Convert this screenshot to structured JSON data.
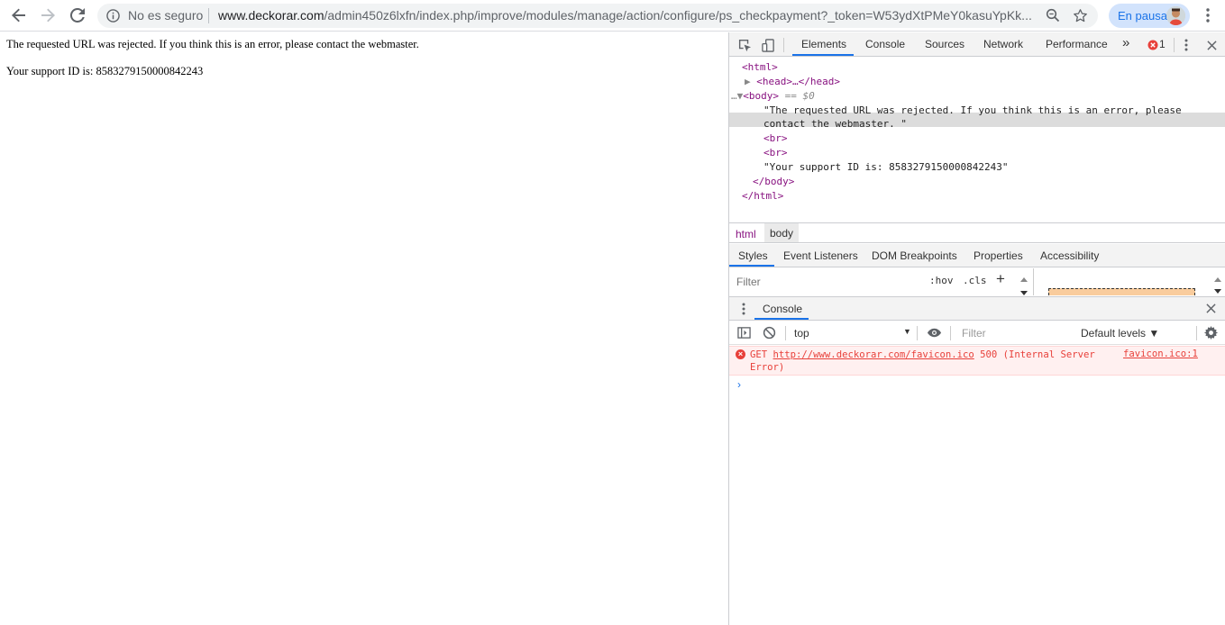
{
  "browser": {
    "security_label": "No es seguro",
    "url_host": "www.deckorar.com",
    "url_path": "/admin450z6lxfn/index.php/improve/modules/manage/action/configure/ps_checkpayment?_token=W53ydXtPMeY0kasuYpKk...",
    "profile_label": "En pausa",
    "icons": [
      "back-icon",
      "forward-icon",
      "reload-icon",
      "info-icon",
      "zoom-icon",
      "star-icon",
      "menu-dots-icon"
    ]
  },
  "page": {
    "line1": "The requested URL was rejected. If you think this is an error, please contact the webmaster.",
    "line2": "Your support ID is: 8583279150000842243"
  },
  "devtools": {
    "tabs": [
      "Elements",
      "Console",
      "Sources",
      "Network",
      "Performance"
    ],
    "more": "»",
    "error_count": "1",
    "dom": {
      "html_open": "<html>",
      "head_collapsed": "<head>…</head>",
      "body_open": "<body>",
      "selected_marker": "== $0",
      "text1": "\"The requested URL was rejected. If you think this is an error, please",
      "text1_cont": "contact the webmaster. \"",
      "br1": "<br>",
      "br2": "<br>",
      "text2": "\"Your support ID is: 8583279150000842243\"",
      "body_close": "</body>",
      "html_close": "</html>"
    },
    "breadcrumbs": [
      "html",
      "body"
    ],
    "sub_tabs": [
      "Styles",
      "Event Listeners",
      "DOM Breakpoints",
      "Properties",
      "Accessibility"
    ],
    "styles_filter_placeholder": "Filter",
    "hov": ":hov",
    "cls": ".cls",
    "plus": "+",
    "drawer_title": "Console",
    "console": {
      "context": "top",
      "filter_placeholder": "Filter",
      "levels": "Default levels ▼",
      "error_method": "GET",
      "error_url": "http://www.deckorar.com/favicon.ico",
      "error_status": "500 (Internal Server",
      "error_status_cont": "Error)",
      "error_source": "favicon.ico:1",
      "prompt": "›"
    }
  },
  "colors": {
    "accent": "#1a73e8",
    "error": "#e8403a",
    "tag": "#881280",
    "attr": "#994500"
  }
}
